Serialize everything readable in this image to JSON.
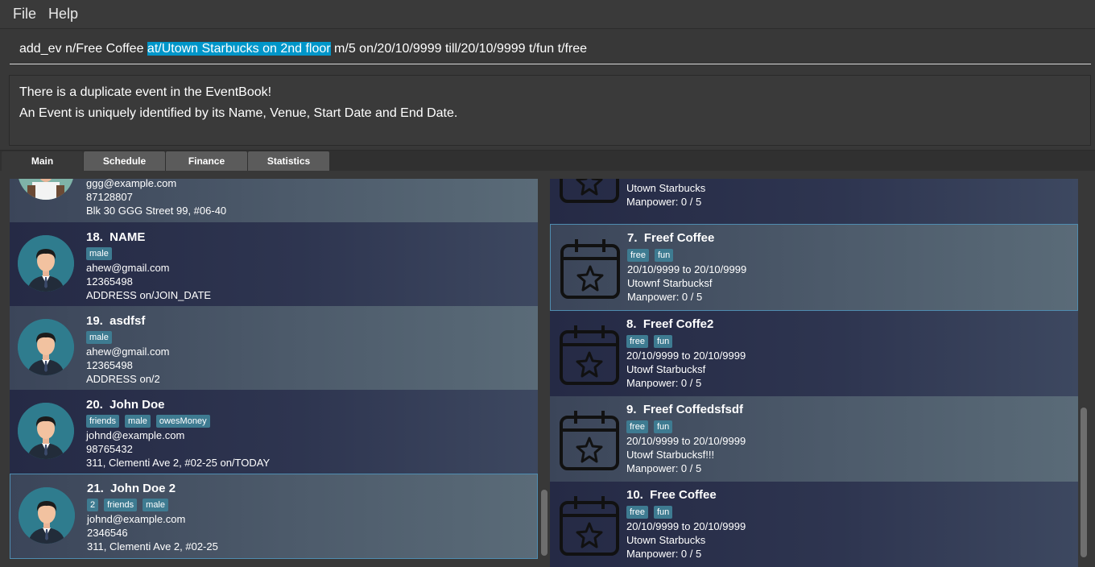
{
  "menu": {
    "file": "File",
    "help": "Help"
  },
  "command": {
    "before": "add_ev n/Free Coffee ",
    "selected": "at/Utown Starbucks on 2nd floor",
    "after": " m/5 on/20/10/9999 till/20/10/9999 t/fun t/free"
  },
  "result": {
    "line1": "There is a duplicate event in the EventBook!",
    "line2": "An Event is uniquely identified by its Name, Venue, Start Date and End Date."
  },
  "tabs": [
    "Main",
    "Schedule",
    "Finance",
    "Statistics"
  ],
  "persons": [
    {
      "email": "ggg@example.com",
      "phone": "87128807",
      "address": "Blk 30 GGG Street 99, #06-40"
    },
    {
      "title": "18.  NAME",
      "tags": [
        "male"
      ],
      "email": "ahew@gmail.com",
      "phone": "12365498",
      "address": "ADDRESS on/JOIN_DATE"
    },
    {
      "title": "19.  asdfsf",
      "tags": [
        "male"
      ],
      "email": "ahew@gmail.com",
      "phone": "12365498",
      "address": "ADDRESS on/2"
    },
    {
      "title": "20.  John Doe",
      "tags": [
        "friends",
        "male",
        "owesMoney"
      ],
      "email": "johnd@example.com",
      "phone": "98765432",
      "address": "311, Clementi Ave 2, #02-25 on/TODAY"
    },
    {
      "title": "21.  John Doe 2",
      "tags": [
        "2",
        "friends",
        "male"
      ],
      "email": "johnd@example.com",
      "phone": "2346546",
      "address": "311, Clementi Ave 2, #02-25"
    }
  ],
  "events": [
    {
      "venue": "Utown Starbucks",
      "manpower": "Manpower: 0 / 5"
    },
    {
      "title": "7.  Freef Coffee",
      "tags": [
        "free",
        "fun"
      ],
      "dates": "20/10/9999 to 20/10/9999",
      "venue": "Utownf Starbucksf",
      "manpower": "Manpower: 0 / 5"
    },
    {
      "title": "8.  Freef Coffe2",
      "tags": [
        "free",
        "fun"
      ],
      "dates": "20/10/9999 to 20/10/9999",
      "venue": "Utowf Starbucksf",
      "manpower": "Manpower: 0 / 5"
    },
    {
      "title": "9.  Freef Coffedsfsdf",
      "tags": [
        "free",
        "fun"
      ],
      "dates": "20/10/9999 to 20/10/9999",
      "venue": "Utowf Starbucksf!!!",
      "manpower": "Manpower: 0 / 5"
    },
    {
      "title": "10.  Free Coffee",
      "tags": [
        "free",
        "fun"
      ],
      "dates": "20/10/9999 to 20/10/9999",
      "venue": "Utown Starbucks",
      "manpower": "Manpower: 0 / 5"
    }
  ]
}
